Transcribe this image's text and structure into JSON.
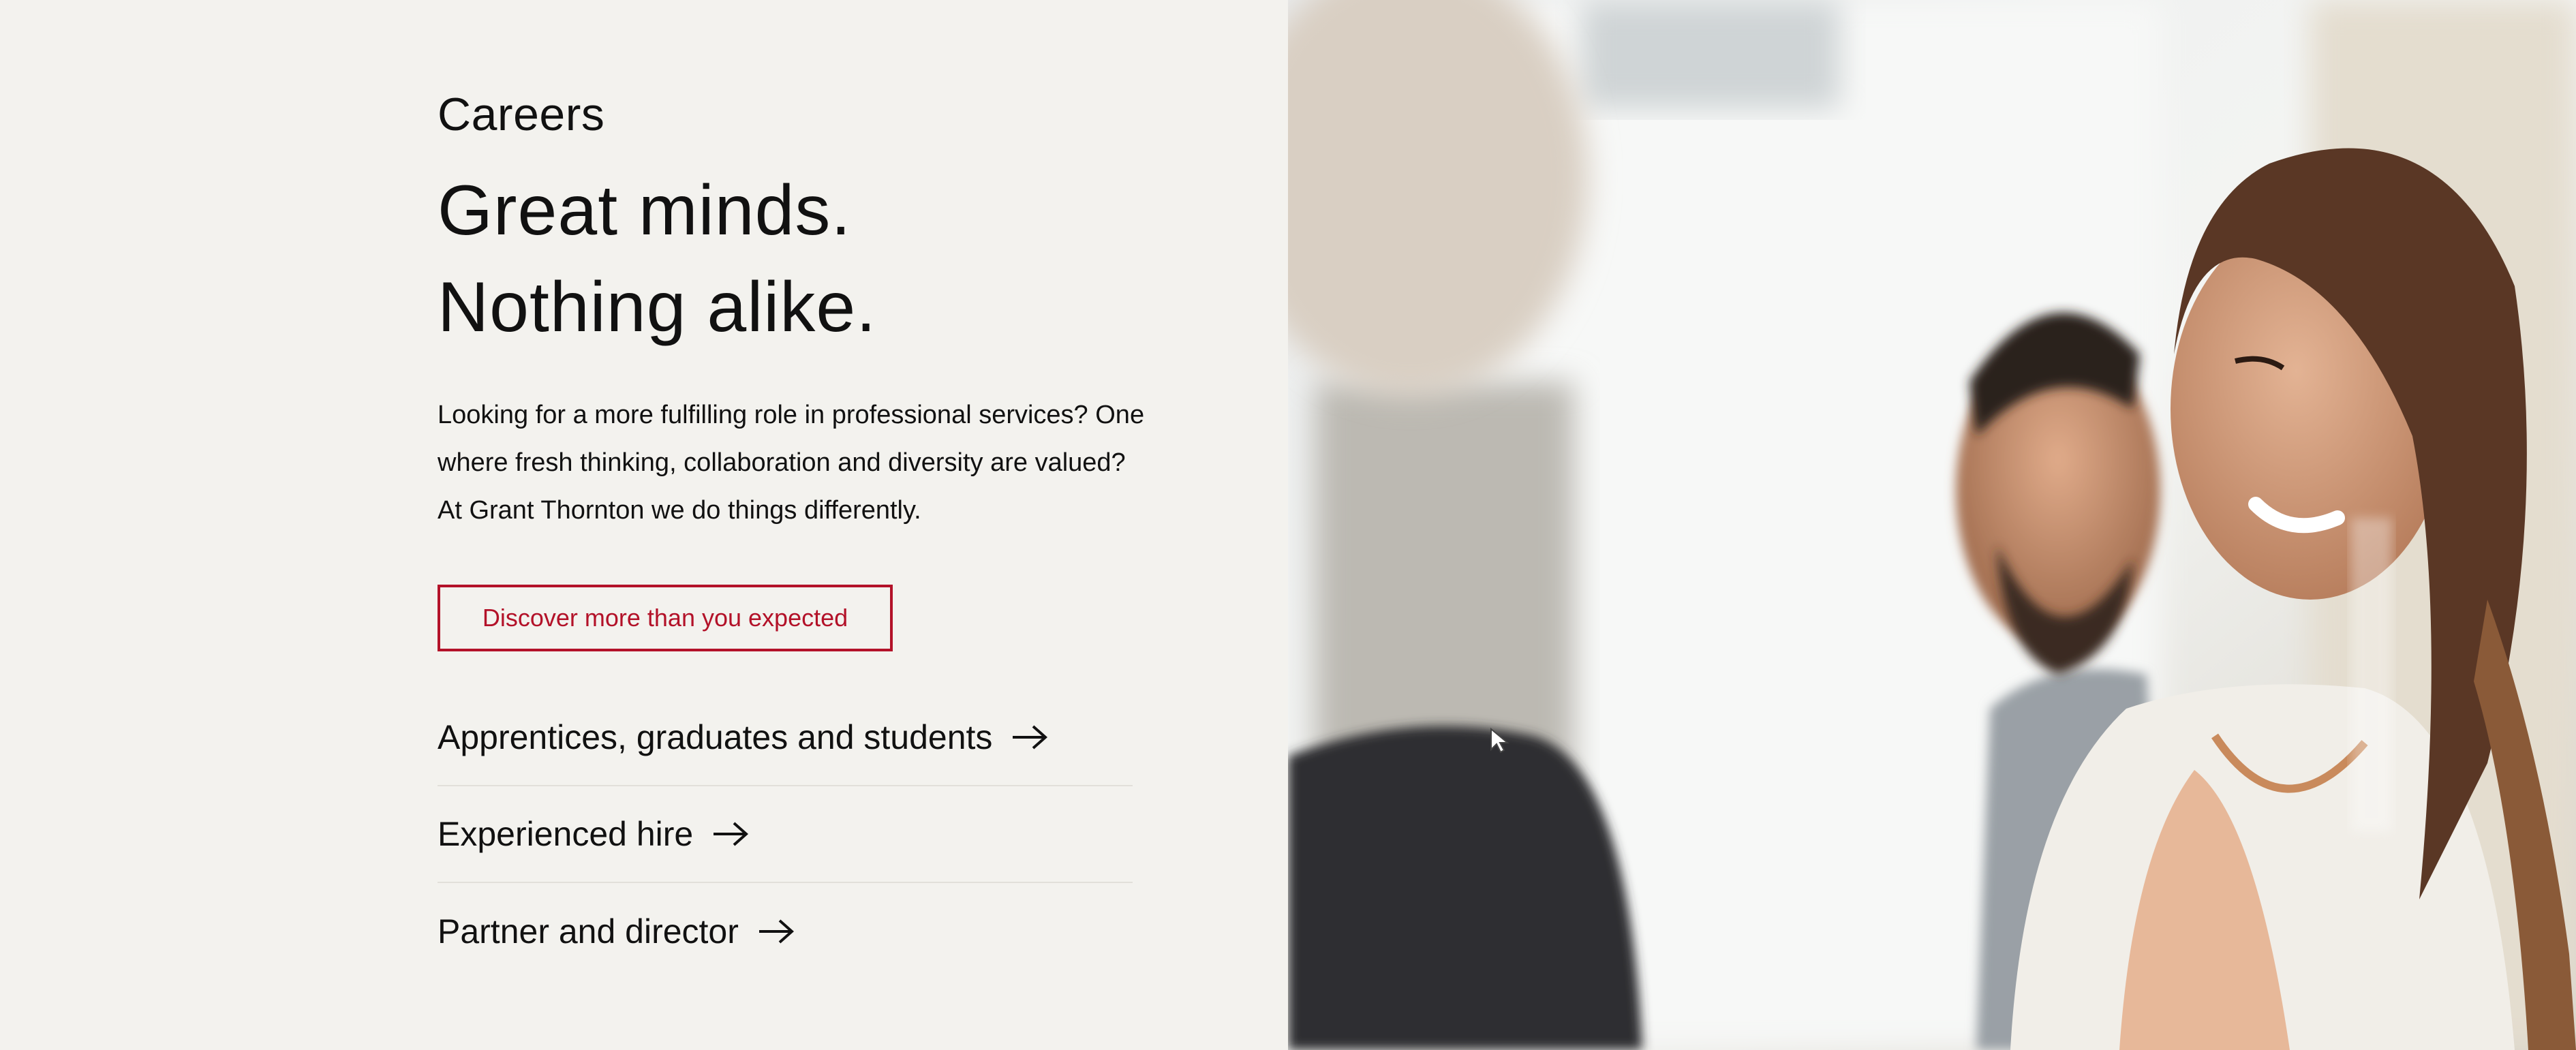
{
  "hero": {
    "eyebrow": "Careers",
    "headline_line1": "Great minds.",
    "headline_line2": "Nothing alike.",
    "intro": "Looking for a more fulfilling role in professional services? One where fresh thinking, collaboration and diversity are valued? At Grant Thornton we do things differently.",
    "cta_label": "Discover more than you expected"
  },
  "career_links": [
    {
      "label": "Apprentices, graduates and students",
      "icon": "arrow-right-icon"
    },
    {
      "label": "Experienced hire",
      "icon": "arrow-right-icon"
    },
    {
      "label": "Partner and director",
      "icon": "arrow-right-icon"
    }
  ],
  "colors": {
    "background": "#f3f2ee",
    "accent": "#b31229",
    "text": "#111111"
  },
  "image": {
    "name": "hero-photo-colleagues"
  }
}
